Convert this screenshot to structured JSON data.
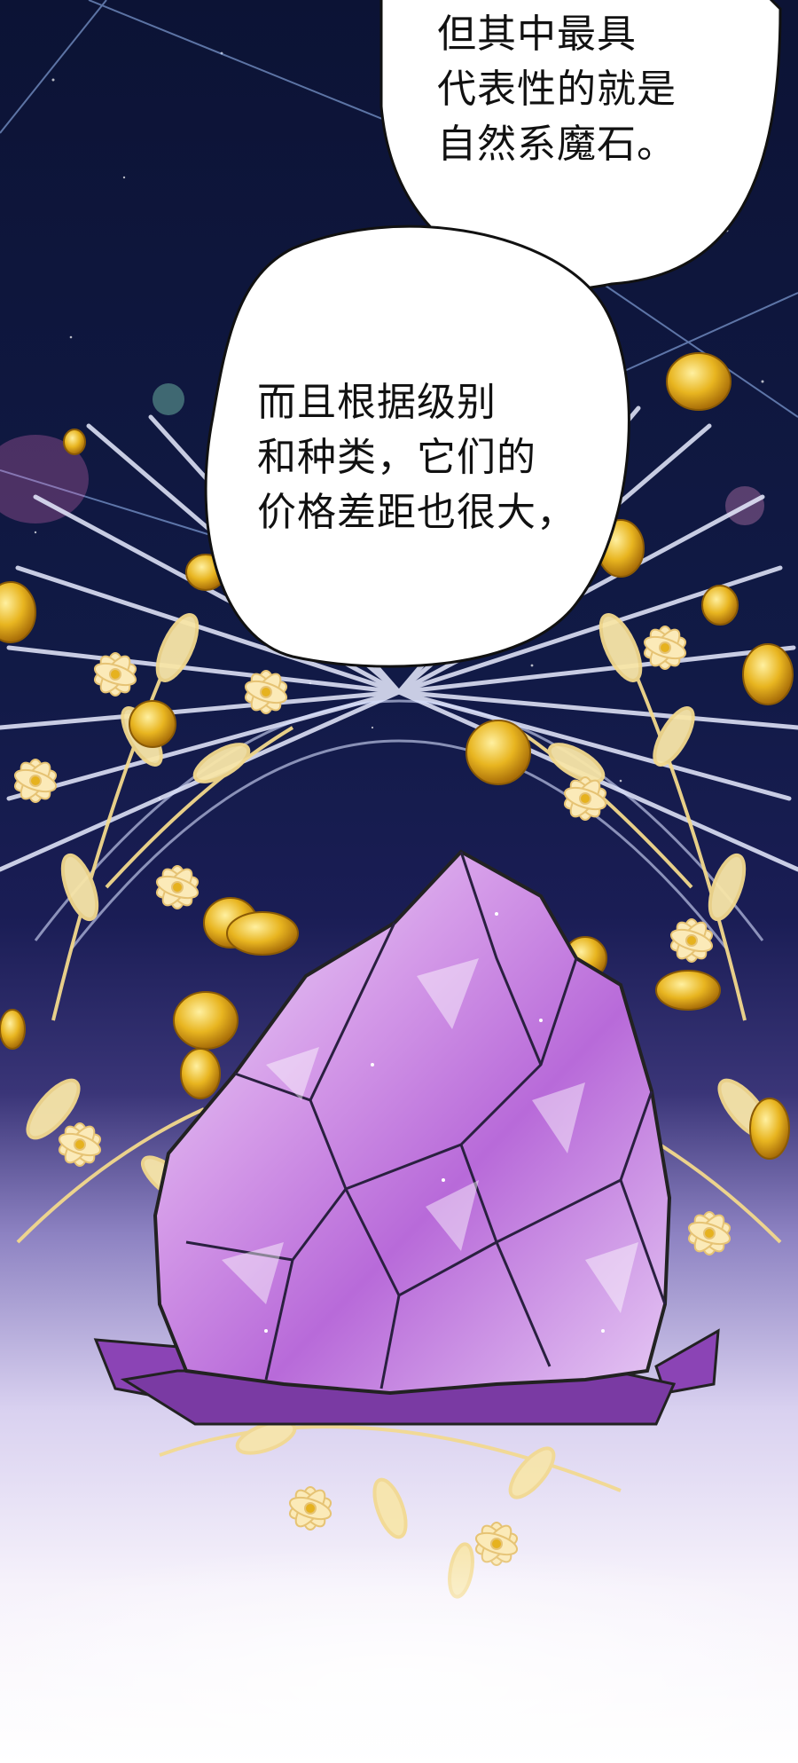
{
  "bubbles": [
    {
      "lines": [
        "但其中最具",
        "代表性的就是",
        "自然系魔石。"
      ]
    },
    {
      "lines": [
        "而且根据级别",
        "和种类，它们的",
        "价格差距也很大，"
      ]
    }
  ],
  "colors": {
    "night_sky": "#0f1538",
    "crystal_main": "#c98ae6",
    "crystal_light": "#e8d9f7",
    "crystal_base": "#7a3aa3",
    "coin_gold": "#e6b21f",
    "flower_gold": "#f3d98c"
  },
  "icons": [
    "coin-icon",
    "flower-icon",
    "crystal-stone"
  ]
}
